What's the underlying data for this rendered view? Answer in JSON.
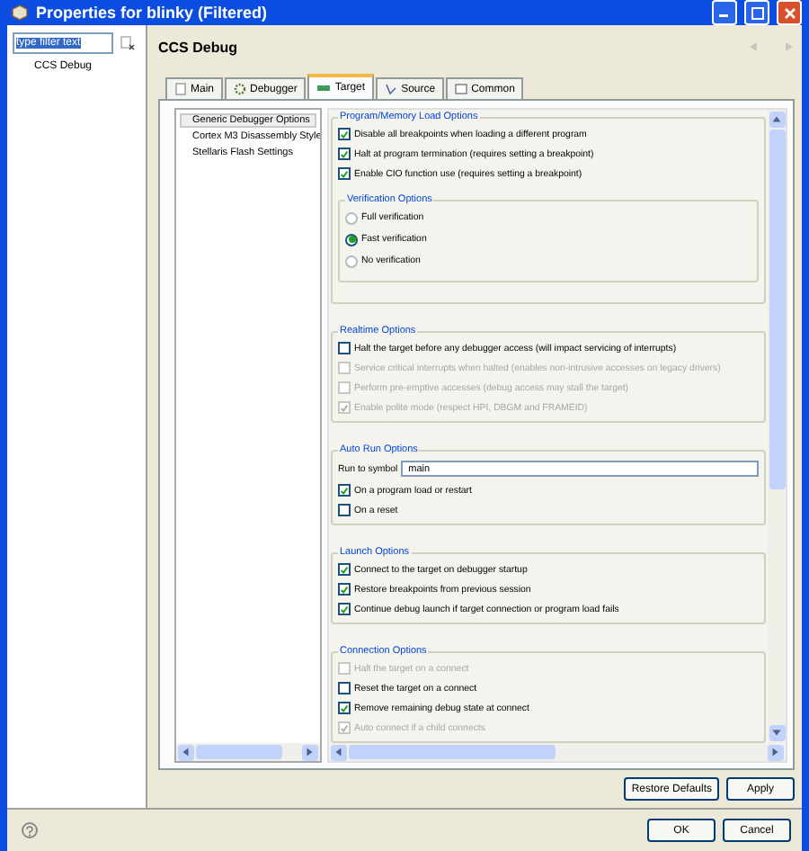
{
  "window": {
    "title": "Properties for blinky (Filtered)"
  },
  "filter": {
    "value": "type filter text"
  },
  "sidebar": {
    "items": [
      {
        "label": "CCS Debug",
        "selected": false
      }
    ]
  },
  "page": {
    "title": "CCS Debug"
  },
  "tabs": [
    {
      "label": "Main",
      "selected": false
    },
    {
      "label": "Debugger",
      "selected": false
    },
    {
      "label": "Target",
      "selected": true
    },
    {
      "label": "Source",
      "selected": false
    },
    {
      "label": "Common",
      "selected": false
    }
  ],
  "option_tree": [
    {
      "label": "Generic Debugger Options",
      "selected": true
    },
    {
      "label": "Cortex M3 Disassembly Style",
      "selected": false
    },
    {
      "label": "Stellaris Flash Settings",
      "selected": false
    }
  ],
  "sections": [
    {
      "title": "Program/Memory Load Options",
      "items": [
        {
          "kind": "checkbox",
          "label": "Disable all breakpoints when loading a different program",
          "checked": true,
          "disabled": false
        },
        {
          "kind": "checkbox",
          "label": "Halt at program termination (requires setting a breakpoint)",
          "checked": true,
          "disabled": false
        },
        {
          "kind": "checkbox",
          "label": "Enable CIO function use (requires setting a breakpoint)",
          "checked": true,
          "disabled": false
        },
        {
          "kind": "group",
          "title": "Verification Options",
          "options": [
            {
              "label": "Full verification",
              "selected": false
            },
            {
              "label": "Fast verification",
              "selected": true
            },
            {
              "label": "No verification",
              "selected": false
            }
          ]
        }
      ]
    },
    {
      "title": "Realtime Options",
      "items": [
        {
          "kind": "checkbox",
          "label": "Halt the target before any debugger access (will impact servicing of interrupts)",
          "checked": false,
          "disabled": false
        },
        {
          "kind": "checkbox",
          "label": "Service critical interrupts when halted (enables non-intrusive accesses on legacy drivers)",
          "checked": false,
          "disabled": true
        },
        {
          "kind": "checkbox",
          "label": "Perform pre-emptive accesses (debug access may stall the target)",
          "checked": false,
          "disabled": true
        },
        {
          "kind": "checkbox",
          "label": "Enable polite mode (respect HPI, DBGM and FRAMEID)",
          "checked": true,
          "disabled": true
        }
      ]
    },
    {
      "title": "Auto Run Options",
      "items": [
        {
          "kind": "field",
          "label": "Run to symbol",
          "value": "main"
        },
        {
          "kind": "checkbox",
          "label": "On a program load or restart",
          "checked": true,
          "disabled": false
        },
        {
          "kind": "checkbox",
          "label": "On a reset",
          "checked": false,
          "disabled": false
        }
      ]
    },
    {
      "title": "Launch Options",
      "items": [
        {
          "kind": "checkbox",
          "label": "Connect to the target on debugger startup",
          "checked": true,
          "disabled": false
        },
        {
          "kind": "checkbox",
          "label": "Restore breakpoints from previous session",
          "checked": true,
          "disabled": false
        },
        {
          "kind": "checkbox",
          "label": "Continue debug launch if target connection or program load fails",
          "checked": true,
          "disabled": false
        }
      ]
    },
    {
      "title": "Connection Options",
      "items": [
        {
          "kind": "checkbox",
          "label": "Halt the target on a connect",
          "checked": false,
          "disabled": true
        },
        {
          "kind": "checkbox",
          "label": "Reset the target on a connect",
          "checked": false,
          "disabled": false
        },
        {
          "kind": "checkbox",
          "label": "Remove remaining debug state at connect",
          "checked": true,
          "disabled": false
        },
        {
          "kind": "checkbox",
          "label": "Auto connect if a child connects",
          "checked": true,
          "disabled": true
        }
      ]
    }
  ],
  "page_buttons": [
    "Restore Defaults",
    "Apply"
  ],
  "dialog_buttons": [
    "OK",
    "Cancel"
  ]
}
